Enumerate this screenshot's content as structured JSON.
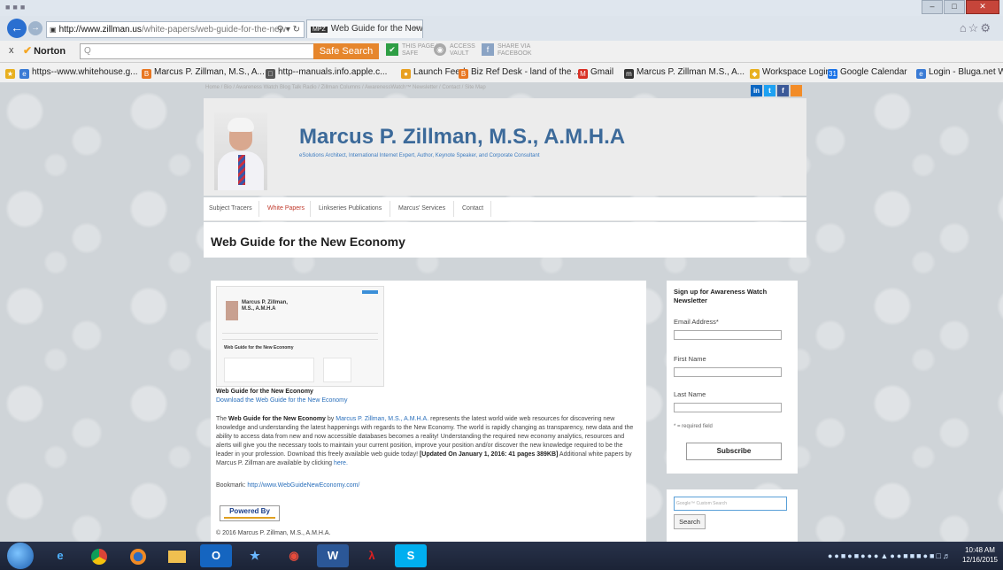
{
  "browser": {
    "address_host": "http://www.zillman.us",
    "address_path": "/white-papers/web-guide-for-the-new-",
    "tab_label": "Web Guide for the New Eco...",
    "tab_icon": "MPZ"
  },
  "norton": {
    "close": "x",
    "brand": "Norton",
    "search_placeholder": "Q",
    "safe_search": "Safe Search",
    "page_status_line1": "THIS PAGE IS",
    "page_status_line2": "SAFE",
    "access_line1": "ACCESS",
    "access_line2": "VAULT",
    "share_line1": "SHARE VIA",
    "share_line2": "FACEBOOK"
  },
  "bookmarks": [
    "https--www.whitehouse.g...",
    "Marcus P. Zillman, M.S., A...",
    "http--manuals.info.apple.c...",
    "Launch Feed",
    "Biz Ref Desk - land of the ...",
    "Gmail",
    "Marcus P. Zillman M.S., A...",
    "Workspace Login",
    "Google Calendar",
    "Login - Bluga.net WebThu..."
  ],
  "site": {
    "top_nav": "Home  /  Bio  /  Awareness Watch Blog Talk Radio  /  Zillman Columns  /  AwarenessWatch™ Newsletter  /  Contact  /  Site Map",
    "social": [
      "in",
      "t",
      "f",
      "rss"
    ],
    "name": "Marcus P. Zillman, M.S., A.M.H.A",
    "tagline": "eSolutions Architect, International Internet Expert, Author, Keynote Speaker, and Corporate Consultant",
    "menu": [
      "Subject Tracers",
      "White Papers",
      "Linkseries Publications",
      "Marcus' Services",
      "Contact"
    ],
    "page_title": "Web Guide for the New Economy",
    "thumb": {
      "name": "Marcus P. Zillman, M.S., A.M.H.A",
      "title": "Web Guide for the New Economy"
    },
    "content_title": "Web Guide for the New Economy",
    "download_link": "Download the Web Guide for the New Economy",
    "body": {
      "p1_bold": "Web Guide for the New Economy",
      "p1_by": " by ",
      "author_link": "Marcus P. Zillman, M.S., A.M.H.A.",
      "p1_text": " represents the latest world wide web resources for discovering new knowledge and understanding the latest happenings with regards to the New Economy. The world is rapidly changing as transparency, new data and the ability to access data from new and now accessible databases becomes a reality! Understanding the required new economy analytics, resources and alerts will give you the necessary tools to maintain your current position, improve your position and/or discover the new knowledge required to be the leader in your profession. Download this freely available web guide today! ",
      "p1_update": "[Updated On January 1, 2016: 41 pages 389KB]",
      "p1_tail": " Additional white papers by Marcus P. Zillman are available by clicking ",
      "here_link": "here."
    },
    "bookmark_label": "Bookmark: ",
    "bookmark_url": "http://www.WebGuideNewEconomy.com/",
    "powered_by": "Powered By",
    "copyright": "© 2016 Marcus P. Zillman, M.S., A.M.H.A."
  },
  "newsletter": {
    "title": "Sign up for Awareness Watch Newsletter",
    "email_label": "Email Address*",
    "first_label": "First Name",
    "last_label": "Last Name",
    "required_note": "* = required field",
    "subscribe": "Subscribe"
  },
  "search": {
    "placeholder": "Google™ Custom Search",
    "button": "Search"
  },
  "taskbar": {
    "apps": [
      "IE",
      "Chrome",
      "Firefox",
      "Explorer",
      "Outlook",
      "Network",
      "Gmail",
      "Word",
      "Acrobat",
      "Skype"
    ],
    "time": "10:48 AM",
    "date": "12/16/2015"
  },
  "colors": {
    "accent_link": "#2a6fbb",
    "name_blue": "#3c6a9a",
    "active_menu": "#c0392b",
    "safe_search_orange": "#e6862c"
  }
}
